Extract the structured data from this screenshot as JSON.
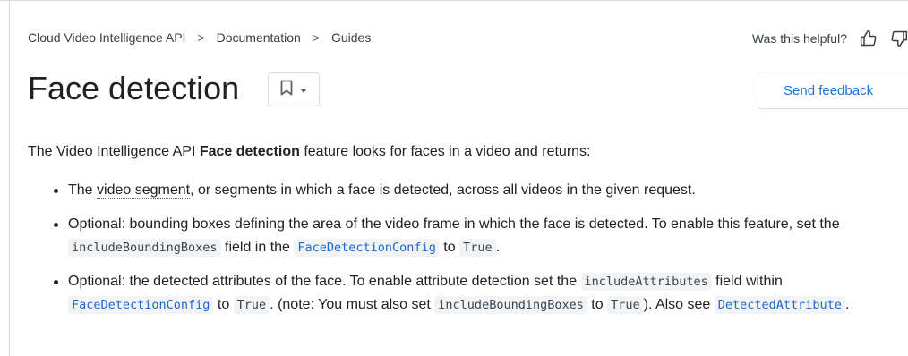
{
  "breadcrumb": {
    "items": [
      "Cloud Video Intelligence API",
      "Documentation",
      "Guides"
    ],
    "separator": ">"
  },
  "helpful": {
    "label": "Was this helpful?",
    "thumb_up_icon": "thumb-up-icon",
    "thumb_down_icon": "thumb-down-icon"
  },
  "page": {
    "title": "Face detection",
    "bookmark_icon": "bookmark-icon",
    "dropdown_icon": "chevron-down-icon",
    "send_feedback": "Send feedback"
  },
  "intro": {
    "before": "The Video Intelligence API ",
    "bold": "Face detection",
    "after": " feature looks for faces in a video and returns:"
  },
  "bullets": {
    "b1": {
      "pre": "The ",
      "term": "video segment",
      "post": ", or segments in which a face is detected, across all videos in the given request."
    },
    "b2": {
      "t1": "Optional: bounding boxes defining the area of the video frame in which the face is detected. To enable this feature, set the ",
      "c1": "includeBoundingBoxes",
      "t2": " field in the ",
      "c2": "FaceDetectionConfig",
      "t3": " to ",
      "c3": "True",
      "t4": "."
    },
    "b3": {
      "t1": "Optional: the detected attributes of the face. To enable attribute detection set the ",
      "c1": "includeAttributes",
      "t2": " field within ",
      "c2": "FaceDetectionConfig",
      "t3": " to ",
      "c3": "True",
      "t4": ". (note: You must also set ",
      "c4": "includeBoundingBoxes",
      "t5": " to ",
      "c5": "True",
      "t6": "). Also see ",
      "c6": "DetectedAttribute",
      "t7": "."
    }
  },
  "colors": {
    "link": "#1a73e8",
    "code_link": "#1967d2",
    "text": "#202124",
    "border": "#dadce0"
  }
}
